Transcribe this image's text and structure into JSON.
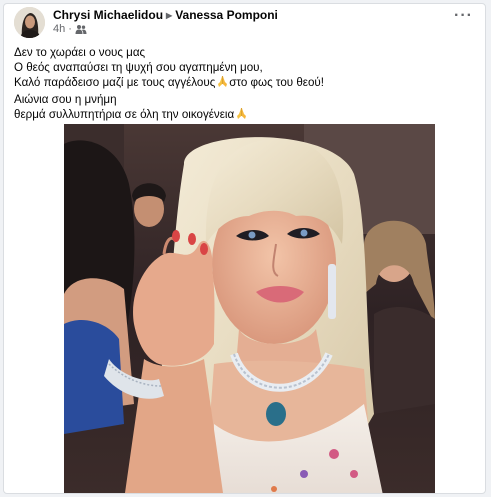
{
  "post": {
    "author": "Chrysi Michaelidou",
    "recipient": "Vanessa Pomponi",
    "timestamp": "4h",
    "more_icon": "more-horizontal-icon",
    "audience_icon": "friends-icon",
    "text_lines": [
      "Δεν το χωράει ο νους μας",
      "Ο θεός αναπαύσει τη ψυχή σου αγαπημένη μου,",
      "Καλό παράδεισο μαζί με τους αγγέλους",
      "στο φως του θεού!",
      "Αιώνια σου η μνήμη",
      "θερμά συλλυπητήρια σε όλη την οικογένεια"
    ],
    "emoji": "folded-hands-icon"
  }
}
